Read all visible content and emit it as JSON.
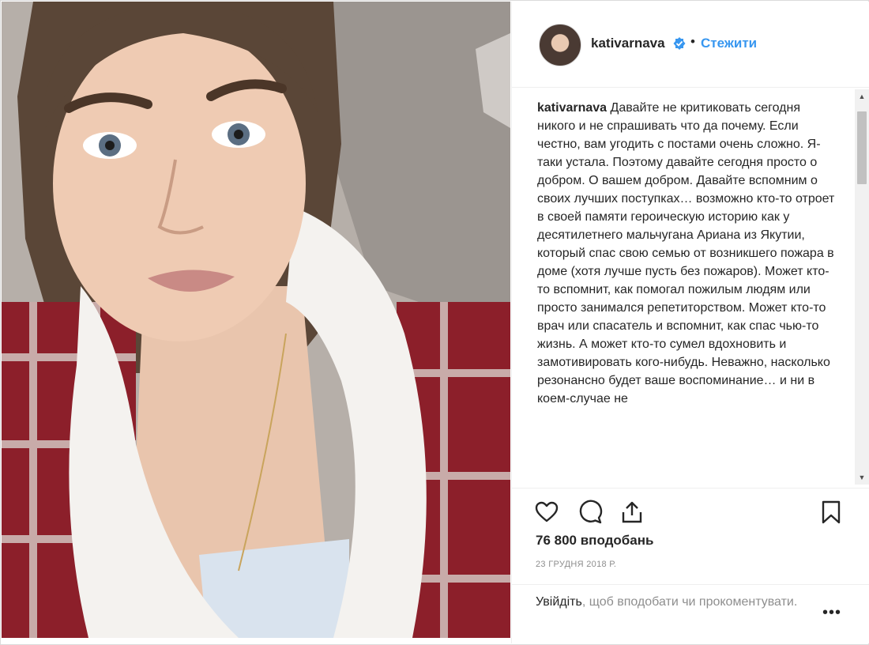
{
  "post": {
    "username": "kativarnava",
    "dot": "•",
    "follow_label": "Стежити",
    "caption_user": "kativarnava",
    "caption_text": "Давайте не критиковать сегодня никого и не спрашивать что да почему. Если честно, вам угодить с постами очень сложно. Я-таки устала. Поэтому давайте сегодня просто о добром. О вашем добром. Давайте вспомним о своих лучших поступках… возможно кто-то отроет в своей памяти героическую историю как у десятилетнего мальчугана Ариана из Якутии, который спас свою семью от возникшего пожара в доме (хотя лучше пусть без пожаров). Может кто-то вспомнит, как помогал пожилым людям или просто занимался репетиторством. Может кто-то врач или спасатель и вспомнит, как спас чью-то жизнь. А может кто-то сумел вдохновить и замотивировать кого-нибудь. Неважно, насколько резонансно будет ваше воспоминание… и ни в коем-случае не",
    "likes": "76 800 вподобань",
    "date": "23 ГРУДНЯ 2018 Р.",
    "login_link": "Увійдіть",
    "login_rest": ", щоб вподобати чи прокоментувати.",
    "more": "•••"
  },
  "icons": {
    "like": "heart-outline-icon",
    "comment": "comment-bubble-icon",
    "share": "share-upload-icon",
    "save": "bookmark-outline-icon",
    "verified": "verified-badge-icon"
  },
  "colors": {
    "link_blue": "#3897f0",
    "text": "#262626",
    "muted": "#8e8e8e",
    "border": "#efefef"
  }
}
